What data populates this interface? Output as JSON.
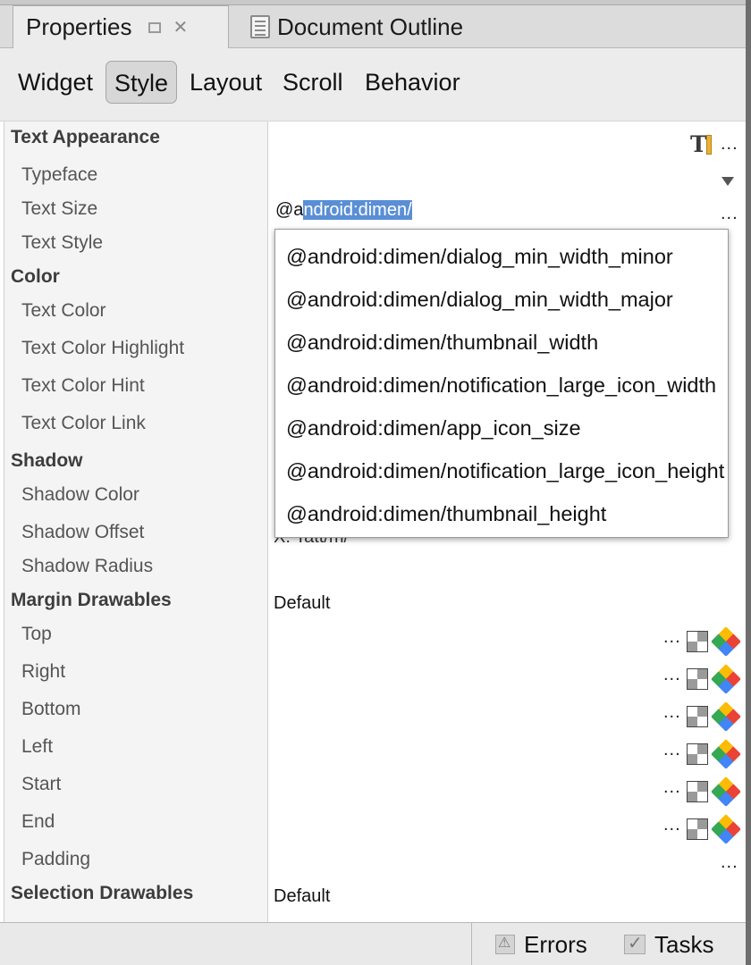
{
  "window_tabs": {
    "properties": "Properties",
    "document_outline": "Document Outline"
  },
  "subtabs": [
    "Widget",
    "Style",
    "Layout",
    "Scroll",
    "Behavior"
  ],
  "selected_subtab": "Style",
  "properties": {
    "text_appearance": "Text Appearance",
    "typeface": "Typeface",
    "text_size": "Text Size",
    "text_style": "Text Style",
    "color": "Color",
    "text_color": "Text Color",
    "text_color_highlight": "Text Color Highlight",
    "text_color_hint": "Text Color Hint",
    "text_color_link": "Text Color Link",
    "shadow": "Shadow",
    "shadow_color": "Shadow Color",
    "shadow_offset": "Shadow Offset",
    "shadow_radius": "Shadow Radius",
    "margin_drawables": "Margin Drawables",
    "top": "Top",
    "right": "Right",
    "bottom": "Bottom",
    "left": "Left",
    "start": "Start",
    "end": "End",
    "padding": "Padding",
    "selection_drawables": "Selection Drawables"
  },
  "values": {
    "text_size_prefix": "@a",
    "text_size_selected": "ndroid:dimen/",
    "margin_drawables_value": "Default",
    "selection_drawables_value": "Default",
    "ellipsis": "...",
    "obscured_text": "X: Tatt/m/"
  },
  "autocomplete": [
    "@android:dimen/dialog_min_width_minor",
    "@android:dimen/dialog_min_width_major",
    "@android:dimen/thumbnail_width",
    "@android:dimen/notification_large_icon_width",
    "@android:dimen/app_icon_size",
    "@android:dimen/notification_large_icon_height",
    "@android:dimen/thumbnail_height"
  ],
  "statusbar": {
    "errors": "Errors",
    "tasks": "Tasks"
  },
  "icons": {
    "text_style": "text-appearance-icon",
    "resource": "resource-chooser-icon",
    "color": "color-picker-icon"
  }
}
